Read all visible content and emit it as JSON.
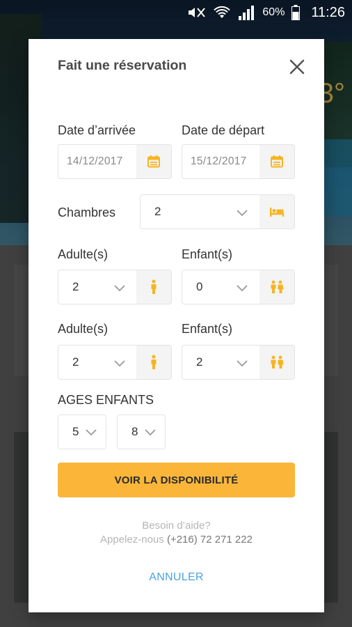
{
  "status_bar": {
    "battery": "60%",
    "time": "11:26"
  },
  "background": {
    "temperature_fragment": "3°"
  },
  "dialog": {
    "title": "Fait une réservation",
    "arrival": {
      "label": "Date d’arrivée",
      "value": "14/12/2017"
    },
    "departure": {
      "label": "Date de départ",
      "value": "15/12/2017"
    },
    "rooms": {
      "label": "Chambres",
      "value": "2"
    },
    "room1": {
      "adults_label": "Adulte(s)",
      "adults_value": "2",
      "children_label": "Enfant(s)",
      "children_value": "0"
    },
    "room2": {
      "adults_label": "Adulte(s)",
      "adults_value": "2",
      "children_label": "Enfant(s)",
      "children_value": "2"
    },
    "ages": {
      "label": "AGES ENFANTS",
      "values": [
        "5",
        "8"
      ]
    },
    "cta_label": "VOIR LA DISPONIBILITÉ",
    "help_line1": "Besoin d’aide?",
    "help_line2_prefix": "Appelez-nous ",
    "help_phone": "(+216) 72 271 222",
    "cancel_label": "ANNULER"
  },
  "colors": {
    "accent": "#fbb63a",
    "icon": "#f5b523",
    "link": "#4aa3df"
  }
}
